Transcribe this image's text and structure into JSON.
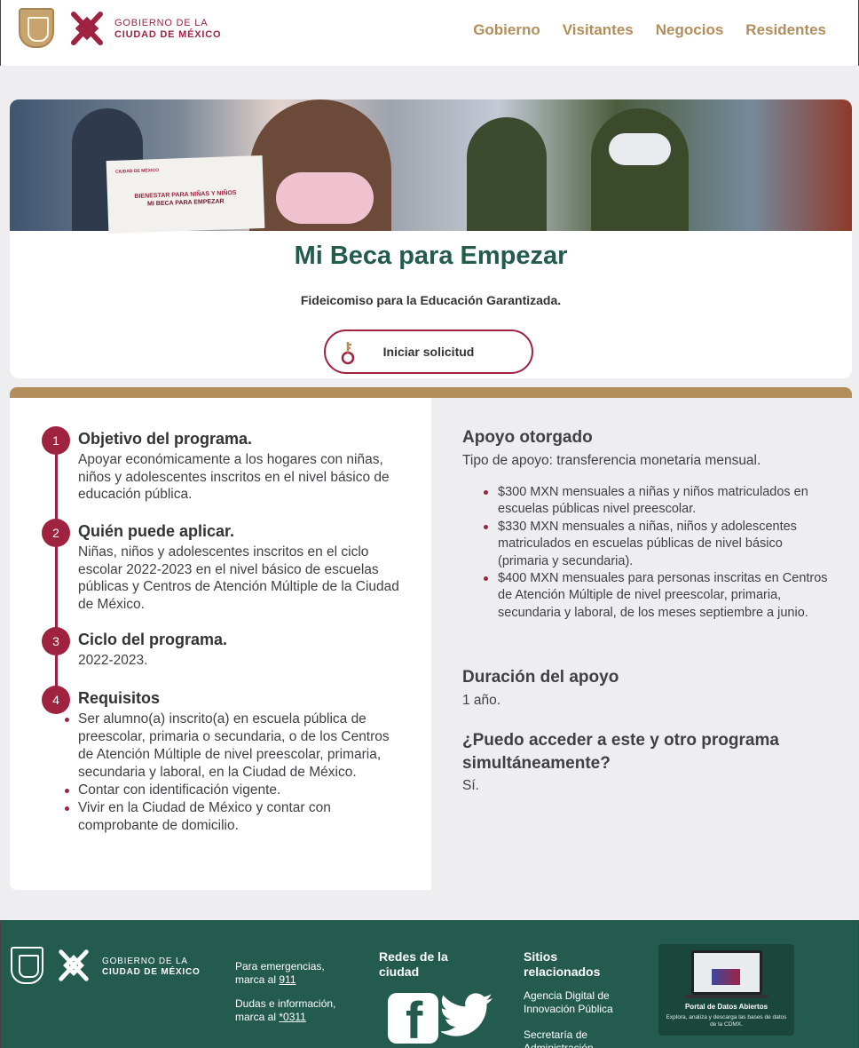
{
  "header": {
    "gov_line1": "GOBIERNO DE LA",
    "gov_line2": "CIUDAD DE MÉXICO",
    "nav": [
      "Gobierno",
      "Visitantes",
      "Negocios",
      "Residentes"
    ]
  },
  "hero": {
    "photo_card_line1": "BIENESTAR PARA NIÑAS Y NIÑOS",
    "photo_card_line2": "MI BECA PARA EMPEZAR",
    "title": "Mi Beca para Empezar",
    "subtitle": "Fideicomiso para la Educación Garantizada.",
    "button_label": "Iniciar solicitud",
    "button_icon": "key-icon"
  },
  "steps": [
    {
      "number": "1",
      "title": "Objetivo del programa.",
      "text": "Apoyar económicamente a los hogares con niñas, niños y adolescentes inscritos en el nivel básico de educación pública."
    },
    {
      "number": "2",
      "title": "Quién puede aplicar.",
      "text": "Niñas, niños y adolescentes inscritos en el ciclo escolar 2022-2023 en el nivel básico de escuelas públicas y Centros de Atención Múltiple de la Ciudad de México."
    },
    {
      "number": "3",
      "title": "Ciclo del programa.",
      "text": "2022-2023."
    },
    {
      "number": "4",
      "title": "Requisitos",
      "items": [
        "Ser alumno(a) inscrito(a) en escuela pública de preescolar, primaria o secundaria, o de los Centros de Atención Múltiple de nivel preescolar, primaria, secundaria y laboral, en la Ciudad de México.",
        "Contar con identificación vigente.",
        "Vivir en la Ciudad de México y contar con comprobante de domicilio."
      ]
    }
  ],
  "support": {
    "heading": "Apoyo otorgado",
    "type_text": "Tipo de apoyo: transferencia monetaria mensual.",
    "items": [
      "$300 MXN mensuales a niñas y niños matriculados en escuelas públicas nivel preescolar.",
      "$330 MXN mensuales a niñas, niños y adolescentes matriculados en escuelas públicas de nivel básico (primaria y secundaria).",
      "$400 MXN mensuales para personas inscritas en Centros de Atención Múltiple de nivel preescolar, primaria, secundaria y laboral, de los meses septiembre a junio."
    ],
    "duration_heading": "Duración del apoyo",
    "duration_text": "1 año.",
    "other_heading": "¿Puedo acceder a este y otro programa simultáneamente?",
    "other_text": "Sí."
  },
  "footer": {
    "gov_line1": "GOBIERNO DE LA",
    "gov_line2": "CIUDAD DE MÉXICO",
    "emerg_text": "Para emergencias, marca al",
    "emerg_link": "911",
    "info_text": "Dudas e información, marca al",
    "info_link": "*0311",
    "social_heading": "Redes de la ciudad",
    "related_heading": "Sitios relacionados",
    "related_links": [
      "Agencia Digital de Innovación Pública",
      "Secretaría de Administración"
    ],
    "portal_title": "Portal de Datos Abiertos",
    "portal_desc": "Explora, analiza y descarga las bases de datos de la CDMX."
  },
  "colors": {
    "guinda": "#9f2241",
    "verde": "#235b4e",
    "dorado": "#b38e5d"
  }
}
